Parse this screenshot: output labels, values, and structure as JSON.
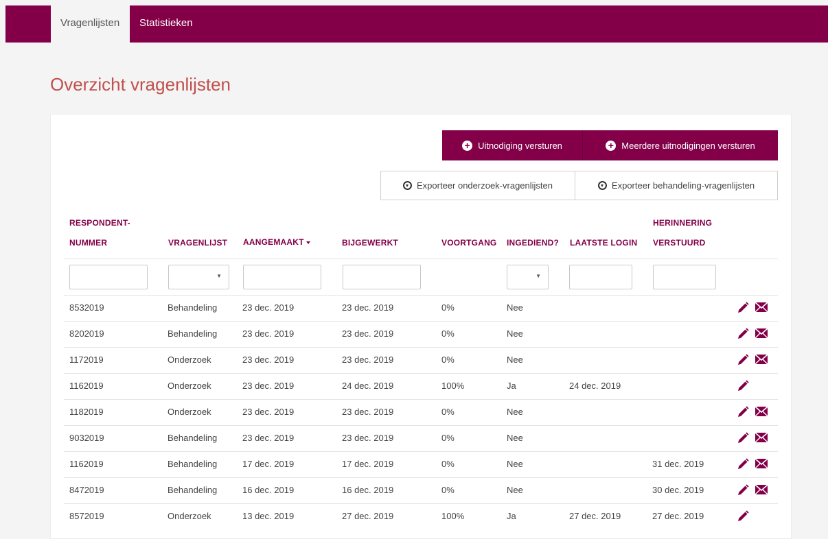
{
  "nav": {
    "tabs": [
      {
        "label": "Vragenlijsten",
        "active": true
      },
      {
        "label": "Statistieken",
        "active": false
      }
    ]
  },
  "page": {
    "title": "Overzicht vragenlijsten"
  },
  "actions": {
    "invite": "Uitnodiging versturen",
    "invite_multiple": "Meerdere uitnodigingen versturen",
    "export_research": "Exporteer onderzoek-vragenlijsten",
    "export_treatment": "Exporteer behandeling-vragenlijsten"
  },
  "table": {
    "headers": {
      "respondent_1": "RESPONDENT-",
      "respondent_2": "NUMMER",
      "vragenlijst": "VRAGENLIJST",
      "aangemaakt": "AANGEMAAKT",
      "bijgewerkt": "BIJGEWERKT",
      "voortgang": "VOORTGANG",
      "ingediend": "INGEDIEND?",
      "laatste_login": "LAATSTE LOGIN",
      "herinnering_1": "HERINNERING",
      "herinnering_2": "VERSTUURD"
    },
    "sort_column": "AANGEMAAKT",
    "rows": [
      {
        "nummer": "8532019",
        "vragenlijst": "Behandeling",
        "aangemaakt": "23 dec. 2019",
        "bijgewerkt": "23 dec. 2019",
        "voortgang": "0%",
        "ingediend": "Nee",
        "laatste_login": "",
        "herinnering": "",
        "mail": true
      },
      {
        "nummer": "8202019",
        "vragenlijst": "Behandeling",
        "aangemaakt": "23 dec. 2019",
        "bijgewerkt": "23 dec. 2019",
        "voortgang": "0%",
        "ingediend": "Nee",
        "laatste_login": "",
        "herinnering": "",
        "mail": true
      },
      {
        "nummer": "1172019",
        "vragenlijst": "Onderzoek",
        "aangemaakt": "23 dec. 2019",
        "bijgewerkt": "23 dec. 2019",
        "voortgang": "0%",
        "ingediend": "Nee",
        "laatste_login": "",
        "herinnering": "",
        "mail": true
      },
      {
        "nummer": "1162019",
        "vragenlijst": "Onderzoek",
        "aangemaakt": "23 dec. 2019",
        "bijgewerkt": "24 dec. 2019",
        "voortgang": "100%",
        "ingediend": "Ja",
        "laatste_login": "24 dec. 2019",
        "herinnering": "",
        "mail": false
      },
      {
        "nummer": "1182019",
        "vragenlijst": "Onderzoek",
        "aangemaakt": "23 dec. 2019",
        "bijgewerkt": "23 dec. 2019",
        "voortgang": "0%",
        "ingediend": "Nee",
        "laatste_login": "",
        "herinnering": "",
        "mail": true
      },
      {
        "nummer": "9032019",
        "vragenlijst": "Behandeling",
        "aangemaakt": "23 dec. 2019",
        "bijgewerkt": "23 dec. 2019",
        "voortgang": "0%",
        "ingediend": "Nee",
        "laatste_login": "",
        "herinnering": "",
        "mail": true
      },
      {
        "nummer": "1162019",
        "vragenlijst": "Behandeling",
        "aangemaakt": "17 dec. 2019",
        "bijgewerkt": "17 dec. 2019",
        "voortgang": "0%",
        "ingediend": "Nee",
        "laatste_login": "",
        "herinnering": "31 dec. 2019",
        "mail": true
      },
      {
        "nummer": "8472019",
        "vragenlijst": "Behandeling",
        "aangemaakt": "16 dec. 2019",
        "bijgewerkt": "16 dec. 2019",
        "voortgang": "0%",
        "ingediend": "Nee",
        "laatste_login": "",
        "herinnering": "30 dec. 2019",
        "mail": true
      },
      {
        "nummer": "8572019",
        "vragenlijst": "Onderzoek",
        "aangemaakt": "13 dec. 2019",
        "bijgewerkt": "27 dec. 2019",
        "voortgang": "100%",
        "ingediend": "Ja",
        "laatste_login": "27 dec. 2019",
        "herinnering": "27 dec. 2019",
        "mail": false
      }
    ]
  },
  "icons": {
    "edit": "pencil-icon",
    "send": "envelope-icon",
    "add": "plus-circle-icon",
    "export": "download-circle-icon"
  },
  "colors": {
    "brand": "#830049",
    "title": "#c0504d"
  }
}
